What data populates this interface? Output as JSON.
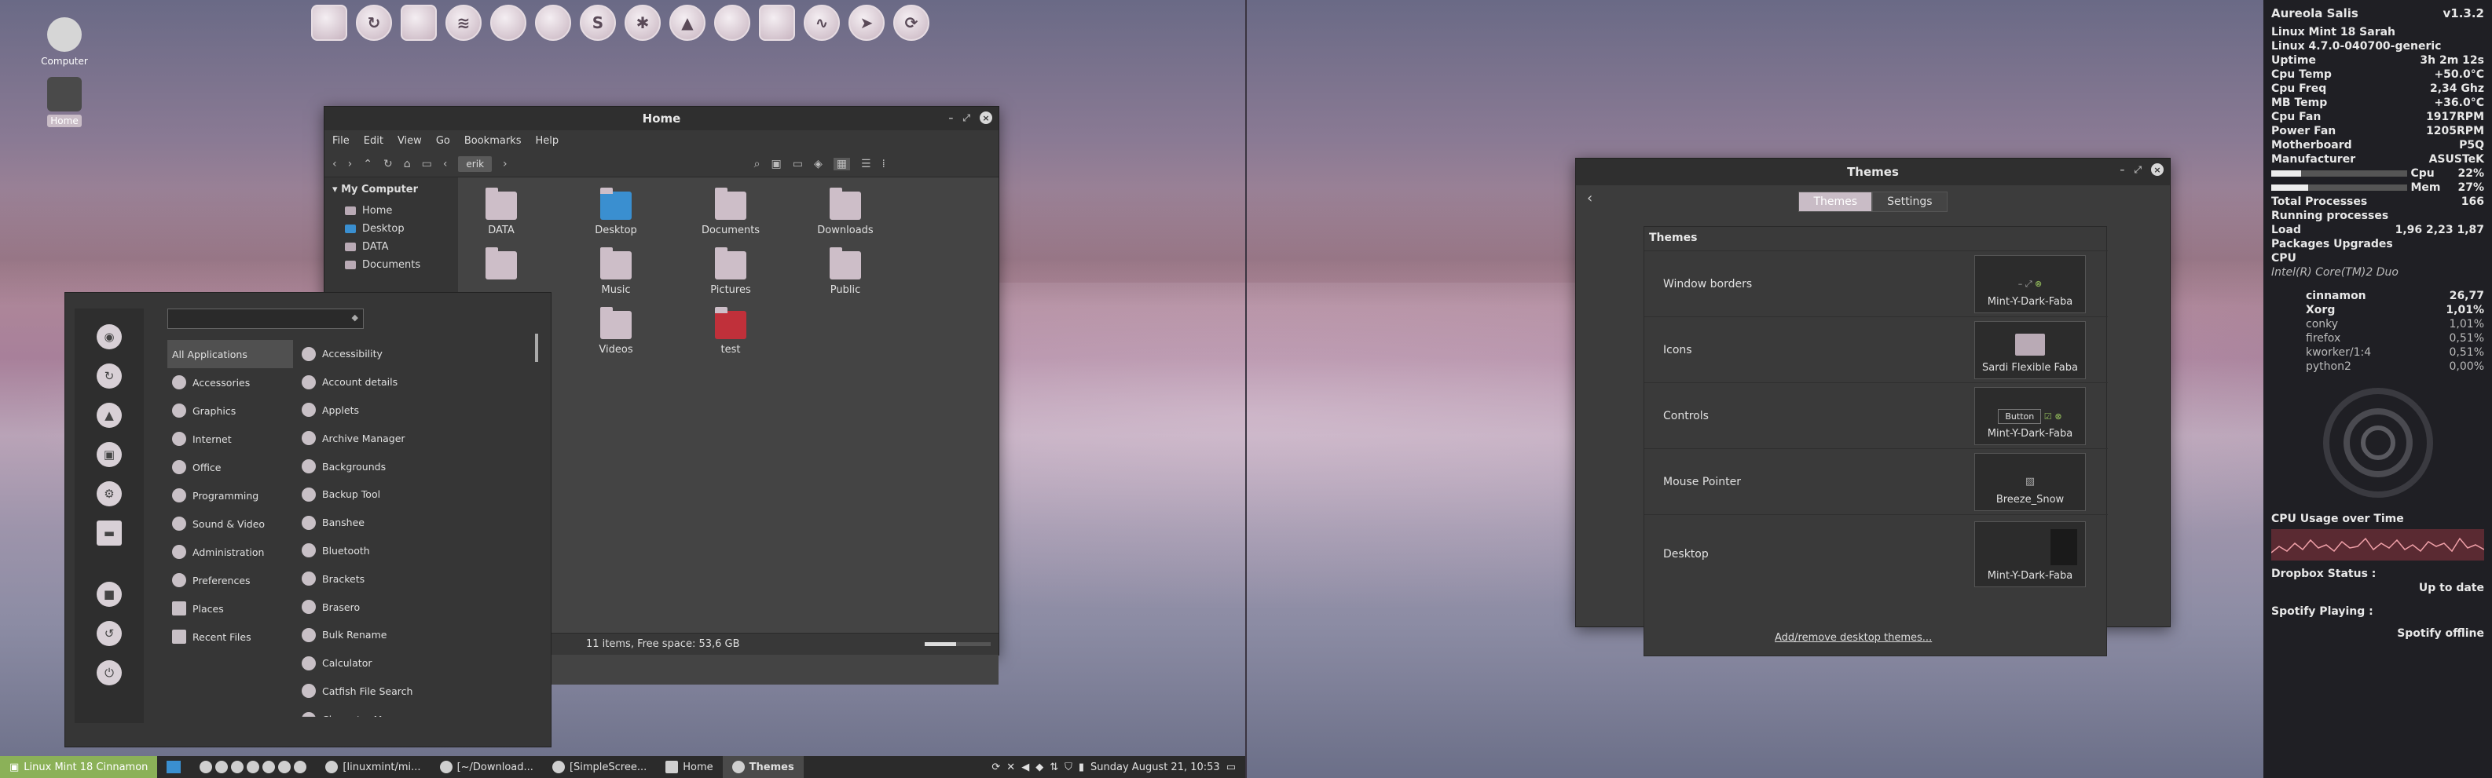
{
  "desktop": {
    "icons": [
      {
        "label": "Computer"
      },
      {
        "label": "Home"
      }
    ]
  },
  "dock": {
    "items": [
      "files-icon",
      "refresh-icon",
      "archive-icon",
      "spotify-icon",
      "cat-icon",
      "globe-icon",
      "skype-icon",
      "settings-icon",
      "vlc-icon",
      "dropbox-icon",
      "crop-icon",
      "pulse-icon",
      "send-icon",
      "sync-icon"
    ]
  },
  "nemo": {
    "title": "Home",
    "menu": [
      "File",
      "Edit",
      "View",
      "Go",
      "Bookmarks",
      "Help"
    ],
    "path": "erik",
    "sidebar": {
      "header": "My Computer",
      "items": [
        "Home",
        "Desktop",
        "DATA",
        "Documents"
      ]
    },
    "files": [
      {
        "name": "DATA"
      },
      {
        "name": "Desktop"
      },
      {
        "name": "Documents"
      },
      {
        "name": "Downloads"
      },
      {
        "name": ""
      },
      {
        "name": "Music"
      },
      {
        "name": "Pictures"
      },
      {
        "name": "Public"
      },
      {
        "name": "Videos"
      },
      {
        "name": "test"
      }
    ],
    "status": "11 items, Free space: 53,6 GB"
  },
  "menu": {
    "search_placeholder": "",
    "categories": [
      "All Applications",
      "Accessories",
      "Graphics",
      "Internet",
      "Office",
      "Programming",
      "Sound & Video",
      "Administration",
      "Preferences",
      "Places",
      "Recent Files"
    ],
    "apps": [
      "Accessibility",
      "Account details",
      "Applets",
      "Archive Manager",
      "Backgrounds",
      "Backup Tool",
      "Banshee",
      "Bluetooth",
      "Brackets",
      "Brasero",
      "Bulk Rename",
      "Calculator",
      "Catfish File Search",
      "Character Map"
    ]
  },
  "panel": {
    "menu_label": "Linux Mint 18 Cinnamon",
    "tasks": [
      "[linuxmint/mi...",
      "[~/Download...",
      "[SimpleScree...",
      "Home",
      "Themes"
    ],
    "clock": "Sunday August 21, 10:53"
  },
  "themes": {
    "title": "Themes",
    "tabs": [
      "Themes",
      "Settings"
    ],
    "section": "Themes",
    "rows": [
      {
        "label": "Window borders",
        "value": "Mint-Y-Dark-Faba"
      },
      {
        "label": "Icons",
        "value": "Sardi Flexible Faba"
      },
      {
        "label": "Controls",
        "value": "Mint-Y-Dark-Faba",
        "button": "Button"
      },
      {
        "label": "Mouse Pointer",
        "value": "Breeze_Snow"
      },
      {
        "label": "Desktop",
        "value": "Mint-Y-Dark-Faba"
      }
    ],
    "link": "Add/remove desktop themes..."
  },
  "conky": {
    "title": "Aureola Salis",
    "version": "v1.3.2",
    "info": [
      [
        "Linux Mint 18 Sarah",
        ""
      ],
      [
        "Linux 4.7.0-040700-generic",
        ""
      ],
      [
        "Uptime",
        "3h 2m 12s"
      ],
      [
        "Cpu Temp",
        "+50.0°C"
      ],
      [
        "Cpu Freq",
        "2,34 Ghz"
      ],
      [
        "MB Temp",
        "+36.0°C"
      ],
      [
        "Cpu Fan",
        "1917RPM"
      ],
      [
        "Power Fan",
        "1205RPM"
      ],
      [
        "Motherboard",
        "P5Q"
      ],
      [
        "Manufacturer",
        "ASUSTeK"
      ]
    ],
    "cpu_label": "Cpu",
    "cpu_pct": "22%",
    "cpu_frac": 0.22,
    "mem_label": "Mem",
    "mem_pct": "27%",
    "mem_frac": 0.27,
    "stats": [
      [
        "Total Processes",
        "166"
      ],
      [
        "Running processes",
        ""
      ],
      [
        "Load",
        "1,96 2,23 1,87"
      ],
      [
        "Packages Upgrades",
        ""
      ],
      [
        "CPU",
        ""
      ]
    ],
    "cpu_model": "Intel(R) Core(TM)2 Duo",
    "procs": [
      [
        "cinnamon",
        "26,77"
      ],
      [
        "Xorg",
        "1,01%"
      ],
      [
        "conky",
        "1,01%"
      ],
      [
        "firefox",
        "0,51%"
      ],
      [
        "kworker/1:4",
        "0,51%"
      ],
      [
        "python2",
        "0,00%"
      ]
    ],
    "graph_title": "CPU Usage over Time",
    "dropbox_label": "Dropbox Status :",
    "dropbox_value": "Up to date",
    "spotify_label": "Spotify Playing :",
    "spotify_value": "Spotify offline"
  }
}
